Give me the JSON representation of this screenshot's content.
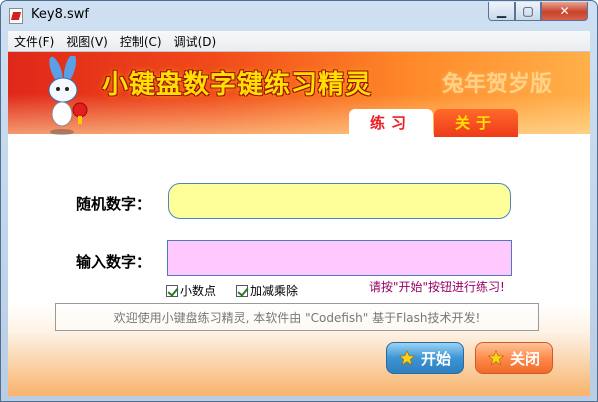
{
  "window": {
    "title": "Key8.swf"
  },
  "menu": [
    "文件(F)",
    "视图(V)",
    "控制(C)",
    "调试(D)"
  ],
  "banner": {
    "title": "小键盘数字键练习精灵",
    "edition": "兔年贺岁版"
  },
  "tabs": [
    {
      "label": "练习",
      "active": true
    },
    {
      "label": "关于",
      "active": false
    }
  ],
  "form": {
    "random_label": "随机数字：",
    "random_value": "",
    "input_label": "输入数字：",
    "input_value": "",
    "hint": "请按\"开始\"按钮进行练习!",
    "checkboxes": [
      {
        "label": "小数点",
        "checked": true
      },
      {
        "label": "加减乘除",
        "checked": true
      }
    ]
  },
  "welcome": "欢迎使用小键盘练习精灵, 本软件由 \"Codefish\" 基于Flash技术开发!",
  "buttons": {
    "start": "开始",
    "close": "关闭"
  },
  "colors": {
    "random_field": "#ffff99",
    "input_field": "#ffc8ff",
    "tab_active_text": "#ee1c25",
    "banner": "#f04a1a"
  }
}
